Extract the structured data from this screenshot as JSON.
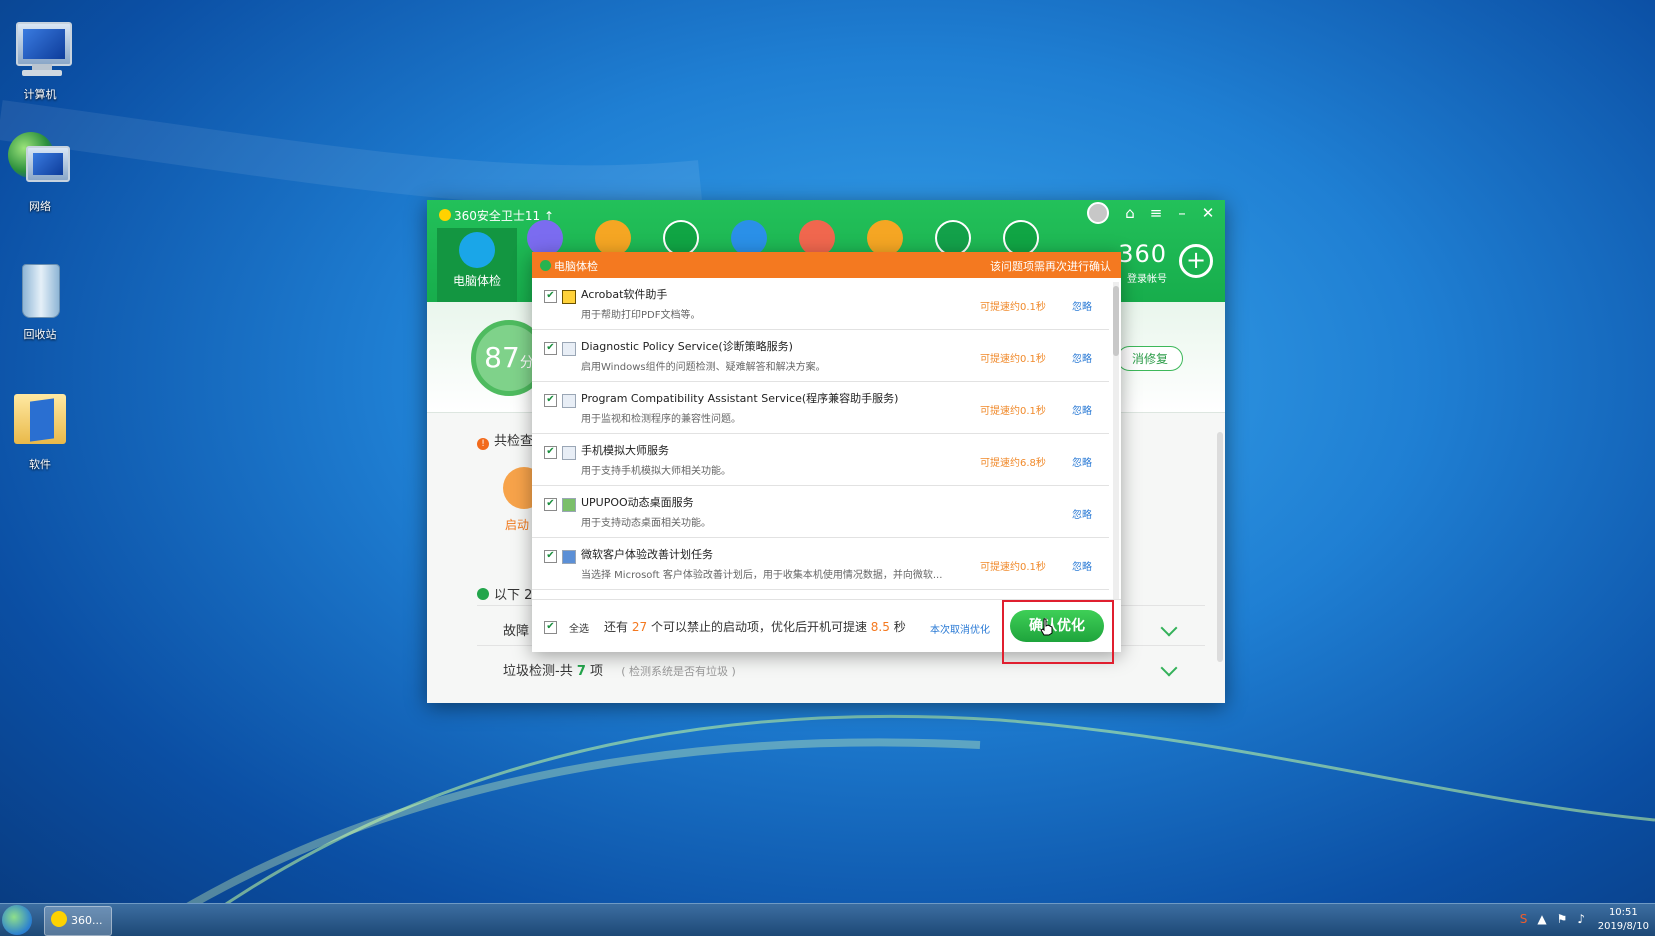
{
  "desktop": {
    "icons": [
      {
        "label": "计算机"
      },
      {
        "label": "网络"
      },
      {
        "label": "回收站"
      },
      {
        "label": "软件"
      }
    ]
  },
  "app": {
    "title": "360安全卫士11",
    "active_tab": "电脑体检",
    "brand": "360",
    "login": "登录帐号",
    "score": "87",
    "score_unit": "分",
    "cancel_fix": "消修复",
    "checked_prefix": "共检查",
    "startup_label": "启动",
    "ok_prefix": "以下 2",
    "fault_row": "故障",
    "junk_row_label": "垃圾检测-共",
    "junk_row_num": "7",
    "junk_row_unit": "项",
    "junk_row_hint": "( 检测系统是否有垃圾 )",
    "colors": {
      "brand_green": "#1db954",
      "popup_orange": "#f47920"
    }
  },
  "popup": {
    "title": "电脑体检",
    "note": "该问题项需再次进行确认",
    "items": [
      {
        "name": "Acrobat软件助手",
        "desc": "用于帮助打印PDF文档等。",
        "speed": "可提速约0.1秒",
        "ignore": "忽略",
        "checked": "✔"
      },
      {
        "name": "Diagnostic Policy Service(诊断策略服务)",
        "desc": "启用Windows组件的问题检测、疑难解答和解决方案。",
        "speed": "可提速约0.1秒",
        "ignore": "忽略",
        "checked": "✔"
      },
      {
        "name": "Program Compatibility Assistant Service(程序兼容助手服务)",
        "desc": "用于监视和检测程序的兼容性问题。",
        "speed": "可提速约0.1秒",
        "ignore": "忽略",
        "checked": "✔"
      },
      {
        "name": "手机模拟大师服务",
        "desc": "用于支持手机模拟大师相关功能。",
        "speed": "可提速约6.8秒",
        "ignore": "忽略",
        "checked": "✔"
      },
      {
        "name": "UPUPOO动态桌面服务",
        "desc": "用于支持动态桌面相关功能。",
        "speed": "",
        "ignore": "忽略",
        "checked": "✔"
      },
      {
        "name": "微软客户体验改善计划任务",
        "desc": "当选择 Microsoft 客户体验改善计划后，用于收集本机使用情况数据，并向微软...",
        "speed": "可提速约0.1秒",
        "ignore": "忽略",
        "checked": "✔"
      }
    ],
    "footer": {
      "select_all": "全选",
      "select_all_check": "✔",
      "msg_prefix": "还有",
      "count": "27",
      "msg_mid": "个可以禁止的启动项，优化后开机可提速",
      "seconds": "8.5",
      "msg_suffix": "秒",
      "undo_label": "本次取消优化",
      "confirm_label": "确认优化"
    }
  },
  "taskbar": {
    "task_label": "360...",
    "time": "10:51",
    "date": "2019/8/10"
  }
}
